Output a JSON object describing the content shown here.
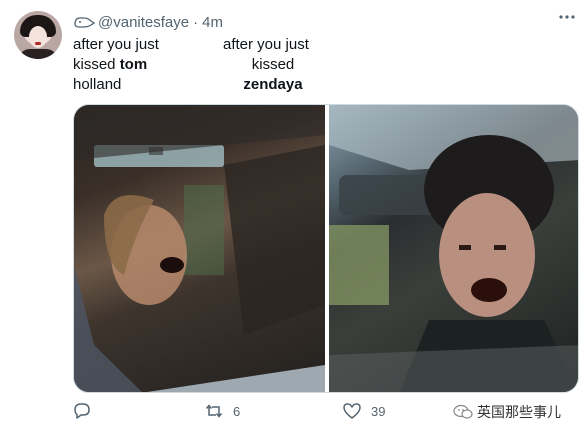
{
  "tweet": {
    "handle": "@vanitesfaye",
    "separator": "·",
    "time": "4m",
    "left_text": {
      "l1": "after you just",
      "l2_a": "kissed ",
      "l2_b": "tom",
      "l3": "holland"
    },
    "right_text": {
      "l1": "after you just",
      "l2": "kissed",
      "l3": "zendaya"
    },
    "media": [
      {
        "desc_icon": "photo-left"
      },
      {
        "desc_icon": "photo-right"
      }
    ],
    "actions": {
      "reply_count": "",
      "retweet_count": "6",
      "like_count": "39"
    },
    "watermark": "英国那些事儿"
  },
  "colors": {
    "secondary_text": "#536471",
    "border": "#cfd9de"
  },
  "icons": [
    "mute-icon",
    "more-icon",
    "reply-icon",
    "retweet-icon",
    "like-icon",
    "wechat-icon"
  ]
}
